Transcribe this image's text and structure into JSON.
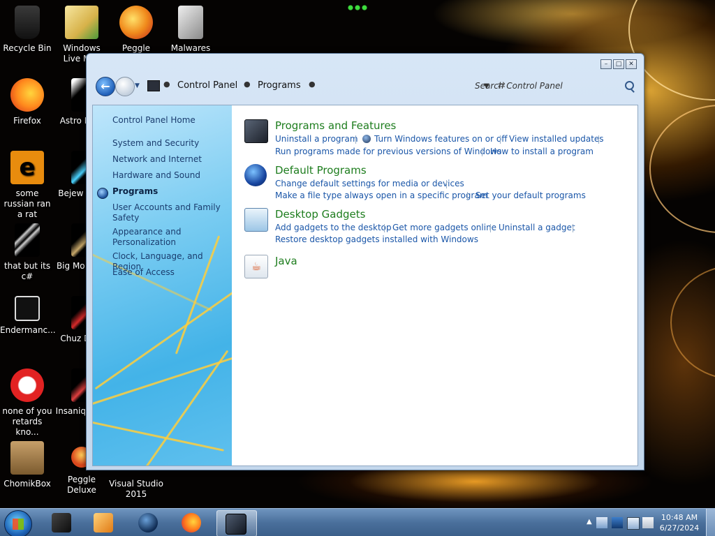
{
  "desktop": {
    "icons": [
      {
        "label": "Recycle Bin",
        "icon": "recycle-bin-icon"
      },
      {
        "label": "Windows Live Mail",
        "icon": "mail-icon"
      },
      {
        "label": "Peggle World",
        "icon": "peggle-icon"
      },
      {
        "label": "Malwares",
        "icon": "folder-icon"
      },
      {
        "label": "Firefox",
        "icon": "firefox-icon"
      },
      {
        "label": "Astro Delu",
        "icon": "game-icon"
      },
      {
        "label": "some russian ran a rat",
        "icon": "app-icon"
      },
      {
        "label": "Bejew Delu",
        "icon": "game-icon"
      },
      {
        "label": "that but its c#",
        "icon": "shortcut-icon"
      },
      {
        "label": "Big Mo Delu",
        "icon": "game-icon"
      },
      {
        "label": "Endermanc...",
        "icon": "app-icon"
      },
      {
        "label": "Chuz Delu",
        "icon": "game-icon"
      },
      {
        "label": "none of you retards kno...",
        "icon": "app-icon"
      },
      {
        "label": "Insaniq Delu",
        "icon": "game-icon"
      },
      {
        "label": "ChomikBox",
        "icon": "chomikbox-icon"
      },
      {
        "label": "Peggle Deluxe",
        "icon": "peggle-icon"
      },
      {
        "label": "Visual Studio 2015",
        "icon": "visual-studio-icon"
      }
    ]
  },
  "window": {
    "breadcrumb": {
      "root": "Control Panel",
      "current": "Programs"
    },
    "search_placeholder": "Search Control Panel",
    "sidebar": {
      "items": [
        {
          "label": "Control Panel Home"
        },
        {
          "label": "System and Security"
        },
        {
          "label": "Network and Internet"
        },
        {
          "label": "Hardware and Sound"
        },
        {
          "label": "Programs"
        },
        {
          "label": "User Accounts and Family Safety"
        },
        {
          "label": "Appearance and Personalization"
        },
        {
          "label": "Clock, Language, and Region"
        },
        {
          "label": "Ease of Access"
        }
      ]
    },
    "categories": [
      {
        "title": "Programs and Features",
        "links": [
          "Uninstall a program",
          "Turn Windows features on or off",
          "View installed updates",
          "Run programs made for previous versions of Windows",
          "How to install a program"
        ]
      },
      {
        "title": "Default Programs",
        "links": [
          "Change default settings for media or devices",
          "Make a file type always open in a specific program",
          "Set your default programs"
        ]
      },
      {
        "title": "Desktop Gadgets",
        "links": [
          "Add gadgets to the desktop",
          "Get more gadgets online",
          "Uninstall a gadget",
          "Restore desktop gadgets installed with Windows"
        ]
      },
      {
        "title": "Java",
        "links": []
      }
    ]
  },
  "taskbar": {
    "clock_time": "10:48 AM",
    "clock_date": "6/27/2024",
    "apps": [
      "explorer-icon",
      "media-player-icon",
      "globe-icon",
      "firefox-icon",
      "control-panel-icon"
    ]
  }
}
